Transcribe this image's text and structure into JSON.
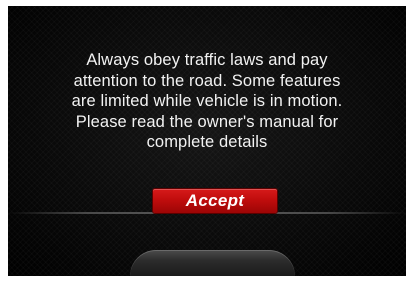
{
  "dialog": {
    "message_lines": [
      "Always obey traffic laws and pay",
      "attention to the road. Some features",
      "are limited while vehicle is in motion.",
      "Please read the owner's manual for",
      "complete details"
    ],
    "accept_label": "Accept"
  },
  "colors": {
    "background": "#000000",
    "text": "#f2f2f2",
    "accept_button": "#c00d0d"
  }
}
